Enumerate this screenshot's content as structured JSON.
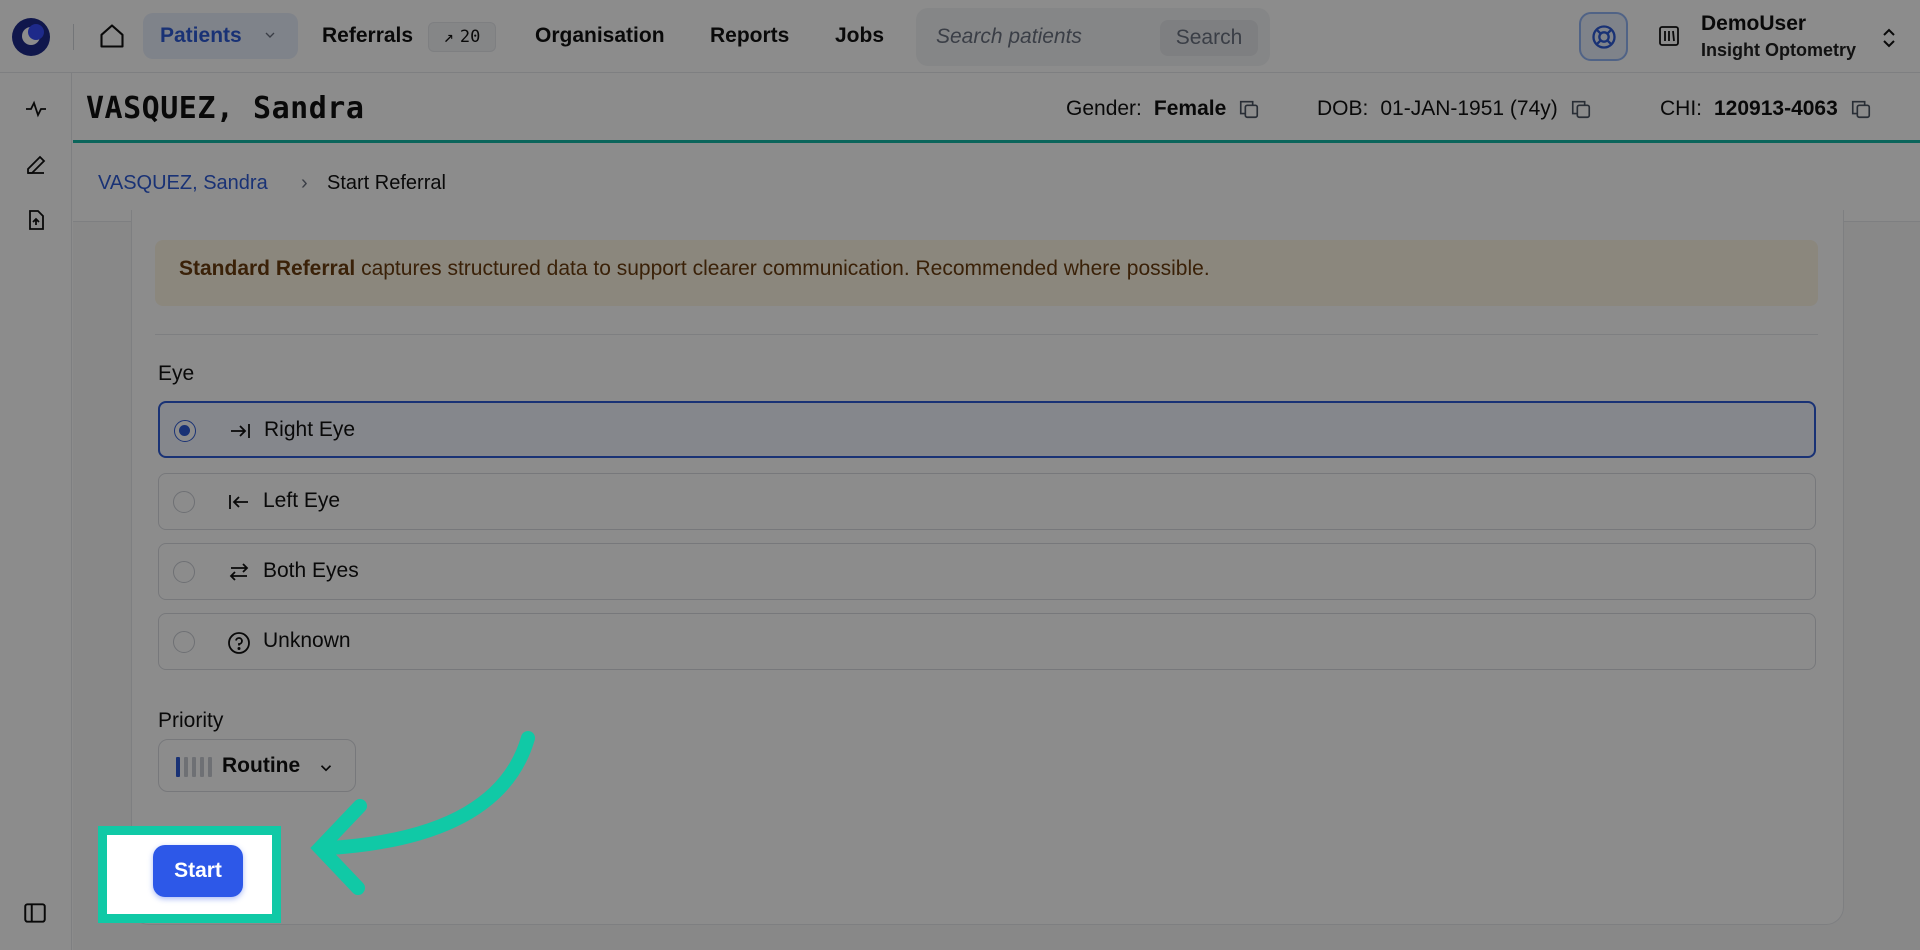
{
  "nav": {
    "patients_label": "Patients",
    "referrals_label": "Referrals",
    "referrals_count": "20",
    "organisation_label": "Organisation",
    "reports_label": "Reports",
    "jobs_label": "Jobs",
    "search_placeholder": "Search patients",
    "search_button": "Search",
    "user_name": "DemoUser",
    "user_org": "Insight Optometry"
  },
  "patient": {
    "name": "VASQUEZ, Sandra",
    "gender_label": "Gender:",
    "gender": "Female",
    "dob_label": "DOB:",
    "dob": "01-JAN-1951 (74y)",
    "chi_label": "CHI:",
    "chi": "120913-4063"
  },
  "breadcrumb": {
    "parent": "VASQUEZ,  Sandra",
    "separator": "›",
    "current": "Start Referral"
  },
  "form": {
    "info_bold": "Standard Referral",
    "info_text": " captures structured data to support clearer communication. Recommended where possible.",
    "eye_label": "Eye",
    "eye_options": [
      {
        "label": "Right Eye",
        "selected": true
      },
      {
        "label": "Left Eye",
        "selected": false
      },
      {
        "label": "Both Eyes",
        "selected": false
      },
      {
        "label": "Unknown",
        "selected": false
      }
    ],
    "priority_label": "Priority",
    "priority_value": "Routine",
    "start_button": "Start"
  },
  "colors": {
    "accent": "#2f5bd6",
    "highlight": "#10c9a6",
    "teal_rule": "#14b8a6",
    "info_bg": "#fdf6e3"
  }
}
